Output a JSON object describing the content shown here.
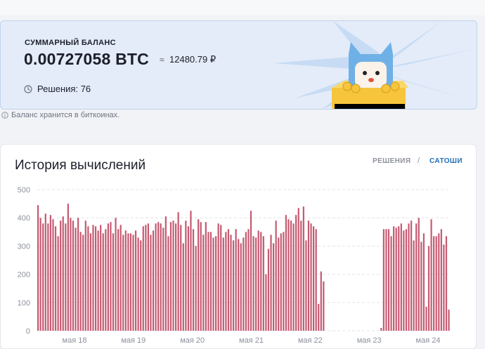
{
  "balance": {
    "label": "СУММАРНЫЙ БАЛАНС",
    "btc": "0.00727058 BTC",
    "approx": "≈",
    "rub": "12480.79 ₽",
    "solutions": "Решения: 76",
    "note": "Баланс хранится в биткоинах."
  },
  "chart_section": {
    "title": "История вычислений",
    "tabs": [
      {
        "label": "РЕШЕНИЯ",
        "active": false
      },
      {
        "label": "САТОШИ",
        "active": true
      }
    ],
    "separator": "/"
  },
  "icons": {
    "clock": "clock-icon",
    "info": "info-icon",
    "mascot": "cat-mascot-with-coins"
  },
  "colors": {
    "bar": "#c65a72",
    "active_tab": "#1f6fb8",
    "card_bg": "#e3ecf8"
  },
  "chart_data": {
    "type": "bar",
    "title": "",
    "xlabel": "",
    "ylabel": "",
    "ylim": [
      0,
      500
    ],
    "yticks": [
      0,
      100,
      200,
      300,
      400,
      500
    ],
    "xtick_labels": [
      "мая 18",
      "мая 19",
      "мая 20",
      "мая 21",
      "мая 22",
      "мая 23",
      "мая 24"
    ],
    "grid": true,
    "values": [
      445,
      400,
      380,
      415,
      380,
      410,
      395,
      370,
      335,
      390,
      405,
      380,
      450,
      400,
      390,
      365,
      400,
      350,
      340,
      390,
      370,
      345,
      375,
      370,
      355,
      375,
      345,
      360,
      380,
      385,
      345,
      400,
      360,
      375,
      340,
      355,
      345,
      345,
      340,
      355,
      330,
      320,
      370,
      375,
      380,
      340,
      355,
      380,
      385,
      380,
      365,
      405,
      335,
      385,
      390,
      380,
      420,
      375,
      310,
      390,
      370,
      425,
      360,
      300,
      395,
      385,
      340,
      385,
      350,
      350,
      330,
      335,
      380,
      375,
      330,
      350,
      360,
      340,
      320,
      360,
      325,
      310,
      330,
      350,
      360,
      425,
      335,
      330,
      355,
      350,
      335,
      200,
      290,
      340,
      310,
      390,
      330,
      345,
      350,
      410,
      395,
      390,
      380,
      410,
      435,
      390,
      440,
      320,
      390,
      380,
      370,
      360,
      95,
      210,
      175,
      0,
      0,
      0,
      0,
      0,
      0,
      0,
      0,
      0,
      0,
      0,
      0,
      0,
      0,
      0,
      0,
      0,
      0,
      0,
      0,
      0,
      0,
      10,
      360,
      360,
      360,
      335,
      370,
      365,
      370,
      380,
      355,
      360,
      380,
      390,
      320,
      380,
      400,
      315,
      345,
      85,
      300,
      395,
      335,
      335,
      345,
      360,
      305,
      335,
      75
    ]
  }
}
